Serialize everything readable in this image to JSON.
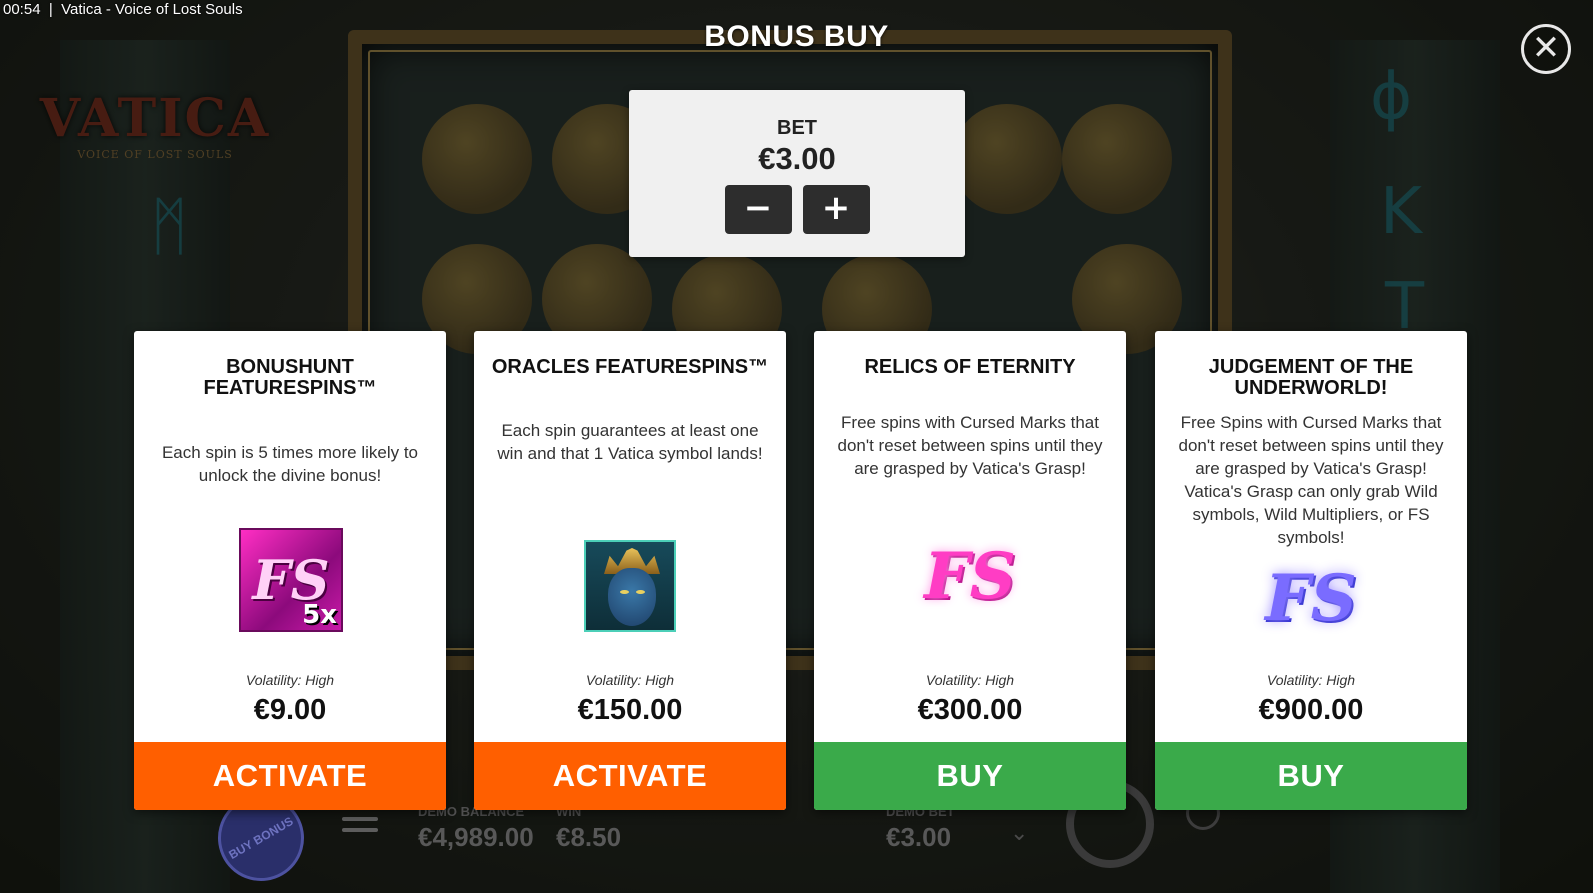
{
  "window": {
    "clock": "00:54",
    "title": "Vatica - Voice of Lost Souls"
  },
  "logo": {
    "name": "VATICA",
    "tagline": "VOICE OF LOST SOULS"
  },
  "dialog": {
    "title": "BONUS BUY",
    "close_icon": "close-icon"
  },
  "bet": {
    "label": "BET",
    "value": "€3.00",
    "decrease": "−",
    "increase": "+"
  },
  "cards": [
    {
      "title": "BONUSHUNT FEATURESPINS™",
      "description": "Each spin is 5 times more likely to unlock the divine bonus!",
      "icon": "fs-5x-icon",
      "icon_text": "FS",
      "icon_badge": "5x",
      "volatility": "Volatility: High",
      "price": "€9.00",
      "action": "ACTIVATE",
      "action_color": "#ff5f00"
    },
    {
      "title": "ORACLES FEATURESPINS™",
      "description": "Each spin guarantees at least one win and that 1 Vatica symbol lands!",
      "icon": "oracle-portrait-icon",
      "volatility": "Volatility: High",
      "price": "€150.00",
      "action": "ACTIVATE",
      "action_color": "#ff5f00"
    },
    {
      "title": "RELICS OF ETERNITY",
      "description": "Free spins with Cursed Marks that don't reset between spins until they are grasped by Vatica's Grasp!",
      "icon": "fs-pink-icon",
      "icon_text": "FS",
      "volatility": "Volatility: High",
      "price": "€300.00",
      "action": "BUY",
      "action_color": "#3aaa4a"
    },
    {
      "title": "JUDGEMENT OF THE UNDERWORLD!",
      "description": "Free Spins with Cursed Marks that don't reset between spins until they are grasped by Vatica's Grasp! Vatica's Grasp can only grab Wild symbols, Wild Multipliers, or FS symbols!",
      "icon": "fs-blue-icon",
      "icon_text": "FS",
      "volatility": "Volatility: High",
      "price": "€900.00",
      "action": "BUY",
      "action_color": "#3aaa4a"
    }
  ],
  "bottom_bar": {
    "buy_bonus": "BUY BONUS",
    "demo_balance_label": "DEMO BALANCE",
    "demo_balance_value": "€4,989.00",
    "win_label": "WIN",
    "win_value": "€8.50",
    "demo_bet_label": "DEMO BET",
    "demo_bet_value": "€3.00"
  }
}
